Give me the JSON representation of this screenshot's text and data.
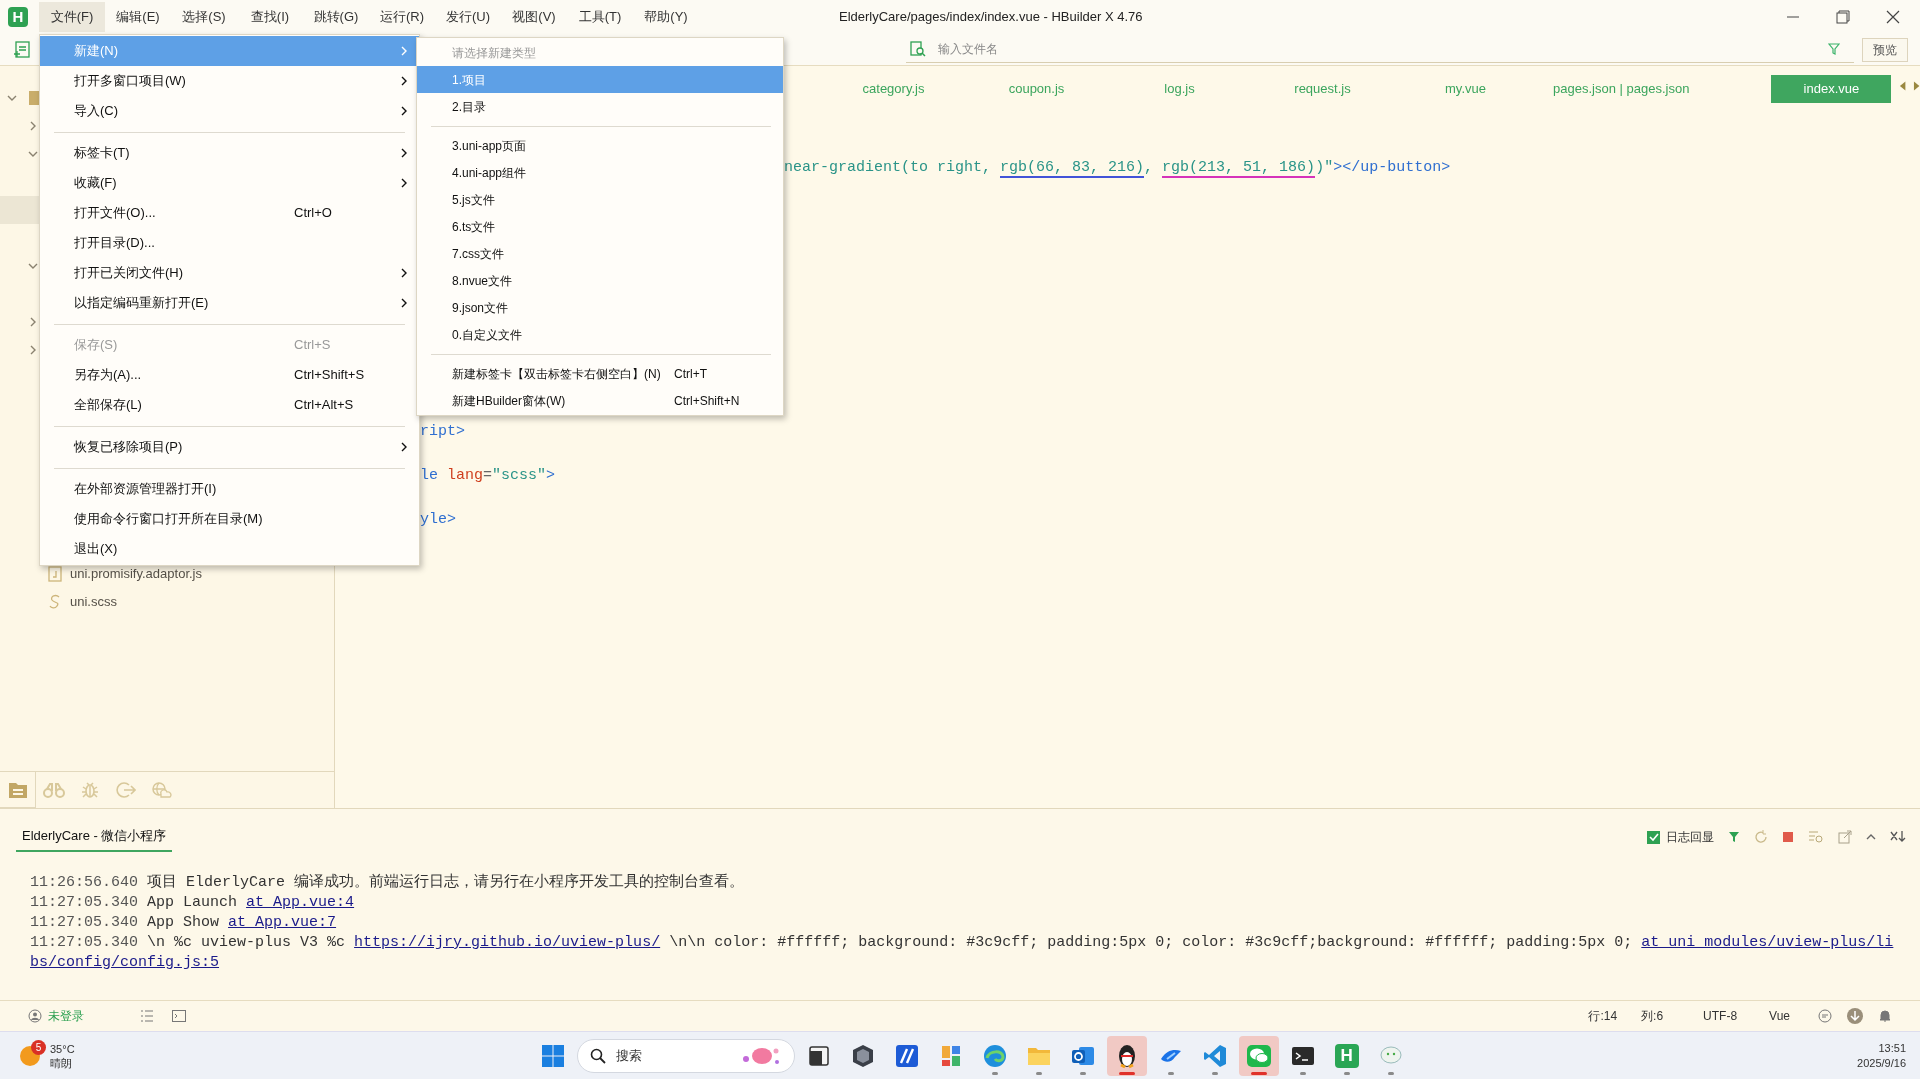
{
  "window": {
    "logo": "H",
    "title": "ElderlyCare/pages/index/index.vue - HBuilder X 4.76"
  },
  "menubar": [
    {
      "label": "文件(F)",
      "selected": true
    },
    {
      "label": "编辑(E)",
      "selected": false
    },
    {
      "label": "选择(S)",
      "selected": false
    },
    {
      "label": "查找(I)",
      "selected": false
    },
    {
      "label": "跳转(G)",
      "selected": false
    },
    {
      "label": "运行(R)",
      "selected": false
    },
    {
      "label": "发行(U)",
      "selected": false
    },
    {
      "label": "视图(V)",
      "selected": false
    },
    {
      "label": "工具(T)",
      "selected": false
    },
    {
      "label": "帮助(Y)",
      "selected": false
    }
  ],
  "file_menu": [
    {
      "kind": "item",
      "label": "新建(N)",
      "submenu": true,
      "selected": true,
      "disabled": false
    },
    {
      "kind": "item",
      "label": "打开多窗口项目(W)",
      "submenu": true,
      "selected": false,
      "disabled": false
    },
    {
      "kind": "item",
      "label": "导入(C)",
      "submenu": true,
      "selected": false,
      "disabled": false
    },
    {
      "kind": "separator"
    },
    {
      "kind": "item",
      "label": "标签卡(T)",
      "submenu": true,
      "selected": false,
      "disabled": false
    },
    {
      "kind": "item",
      "label": "收藏(F)",
      "submenu": true,
      "selected": false,
      "disabled": false
    },
    {
      "kind": "item",
      "label": "打开文件(O)...",
      "shortcut": "Ctrl+O",
      "submenu": false,
      "selected": false,
      "disabled": false
    },
    {
      "kind": "item",
      "label": "打开目录(D)...",
      "submenu": false,
      "selected": false,
      "disabled": false
    },
    {
      "kind": "item",
      "label": "打开已关闭文件(H)",
      "submenu": true,
      "selected": false,
      "disabled": false
    },
    {
      "kind": "item",
      "label": "以指定编码重新打开(E)",
      "submenu": true,
      "selected": false,
      "disabled": false
    },
    {
      "kind": "separator"
    },
    {
      "kind": "item",
      "label": "保存(S)",
      "shortcut": "Ctrl+S",
      "submenu": false,
      "selected": false,
      "disabled": true
    },
    {
      "kind": "item",
      "label": "另存为(A)...",
      "shortcut": "Ctrl+Shift+S",
      "submenu": false,
      "selected": false,
      "disabled": false
    },
    {
      "kind": "item",
      "label": "全部保存(L)",
      "shortcut": "Ctrl+Alt+S",
      "submenu": false,
      "selected": false,
      "disabled": false
    },
    {
      "kind": "separator"
    },
    {
      "kind": "item",
      "label": "恢复已移除项目(P)",
      "submenu": true,
      "selected": false,
      "disabled": false
    },
    {
      "kind": "separator"
    },
    {
      "kind": "item",
      "label": "在外部资源管理器打开(I)",
      "submenu": false,
      "selected": false,
      "disabled": false
    },
    {
      "kind": "item",
      "label": "使用命令行窗口打开所在目录(M)",
      "submenu": false,
      "selected": false,
      "disabled": false
    },
    {
      "kind": "item",
      "label": "退出(X)",
      "submenu": false,
      "selected": false,
      "disabled": false
    }
  ],
  "new_submenu": [
    {
      "kind": "header",
      "label": "请选择新建类型"
    },
    {
      "kind": "item",
      "label": "1.项目",
      "selected": true
    },
    {
      "kind": "item",
      "label": "2.目录",
      "selected": false
    },
    {
      "kind": "separator"
    },
    {
      "kind": "item",
      "label": "3.uni-app页面",
      "selected": false
    },
    {
      "kind": "item",
      "label": "4.uni-app组件",
      "selected": false
    },
    {
      "kind": "item",
      "label": "5.js文件",
      "selected": false
    },
    {
      "kind": "item",
      "label": "6.ts文件",
      "selected": false
    },
    {
      "kind": "item",
      "label": "7.css文件",
      "selected": false
    },
    {
      "kind": "item",
      "label": "8.nvue文件",
      "selected": false
    },
    {
      "kind": "item",
      "label": "9.json文件",
      "selected": false
    },
    {
      "kind": "item",
      "label": "0.自定义文件",
      "selected": false
    },
    {
      "kind": "separator"
    },
    {
      "kind": "item",
      "label": "新建标签卡【双击标签卡右侧空白】(N)",
      "shortcut": "Ctrl+T",
      "selected": false
    },
    {
      "kind": "item",
      "label": "新建HBuilder窗体(W)",
      "shortcut": "Ctrl+Shift+N",
      "selected": false
    }
  ],
  "toolbar": {
    "search": {
      "placeholder": "输入文件名"
    },
    "preview_button": "预览"
  },
  "sidebar": {
    "tree": [
      {
        "kind": "project",
        "expanded": true,
        "selected": false
      },
      {
        "kind": "folder",
        "expanded": false,
        "selected": false
      },
      {
        "kind": "folder",
        "expanded": true,
        "selected": false
      },
      {
        "kind": "row",
        "selected": true
      },
      {
        "kind": "folder",
        "expanded": true,
        "selected": false
      },
      {
        "kind": "folder",
        "expanded": false,
        "selected": false
      },
      {
        "kind": "folder",
        "expanded": false,
        "selected": false
      },
      {
        "kind": "script",
        "label": "uni.promisify.adaptor.js",
        "selected": false
      },
      {
        "kind": "style",
        "label": "uni.scss",
        "selected": false
      }
    ],
    "bottom_tabs": [
      {
        "kind": "folder",
        "selected": true
      },
      {
        "kind": "binoculars",
        "selected": false
      },
      {
        "kind": "bug",
        "selected": false
      },
      {
        "kind": "export",
        "selected": false
      },
      {
        "kind": "cloud",
        "selected": false
      }
    ]
  },
  "tabs": [
    {
      "label": "category.js",
      "selected": false
    },
    {
      "label": "coupon.js",
      "selected": false
    },
    {
      "label": "log.js",
      "selected": false
    },
    {
      "label": "request.js",
      "selected": false
    },
    {
      "label": "my.vue",
      "selected": false
    },
    {
      "label": "pages.json | pages.json",
      "selected": false
    },
    {
      "label": "index.vue",
      "selected": true
    }
  ],
  "code_lines": [
    {
      "segments": [
        {
          "kind": "string",
          "text": "near-gradient(to right, "
        },
        {
          "kind": "string",
          "text": "rgb(66, 83, 216)",
          "color": "#4253d8"
        },
        {
          "kind": "string",
          "text": ", "
        },
        {
          "kind": "string",
          "text": "rgb(213, 51, 186)",
          "color": "#d533ba"
        },
        {
          "kind": "string",
          "text": ")\""
        },
        {
          "kind": "tag",
          "text": "></up-button>"
        }
      ]
    },
    {
      "segments": [
        {
          "kind": "tag",
          "text": "ript>"
        }
      ]
    },
    {
      "segments": [
        {
          "kind": "tag",
          "text": "le "
        },
        {
          "kind": "attr",
          "text": "lang"
        },
        {
          "kind": "plain",
          "text": "="
        },
        {
          "kind": "string",
          "text": "\"scss\""
        },
        {
          "kind": "tag",
          "text": ">"
        }
      ]
    },
    {
      "segments": [
        {
          "kind": "tag",
          "text": "yle>"
        }
      ]
    }
  ],
  "console": {
    "tab": "ElderlyCare - 微信小程序",
    "log_echo": {
      "label": "日志回显",
      "checked": true
    },
    "lines": [
      {
        "segments": [
          {
            "kind": "time",
            "text": "11:26:56.640"
          },
          {
            "kind": "text",
            "text": " 项目 ElderlyCare 编译成功。前端运行日志，请另行在小程序开发工具的控制台查看。"
          }
        ]
      },
      {
        "segments": [
          {
            "kind": "time",
            "text": "11:27:05.340"
          },
          {
            "kind": "text",
            "text": " App Launch "
          },
          {
            "kind": "link",
            "text": "at App.vue:4"
          }
        ]
      },
      {
        "segments": [
          {
            "kind": "time",
            "text": "11:27:05.340"
          },
          {
            "kind": "text",
            "text": " App Show "
          },
          {
            "kind": "link",
            "text": "at App.vue:7"
          }
        ]
      },
      {
        "segments": [
          {
            "kind": "time",
            "text": "11:27:05.340"
          },
          {
            "kind": "text",
            "text": " \\n %c uview-plus V3 %c "
          },
          {
            "kind": "link",
            "text": "https://ijry.github.io/uview-plus/"
          },
          {
            "kind": "text",
            "text": " \\n\\n color: #ffffff; background: #3c9cff; padding:5px 0; color: #3c9cff;background: #ffffff; padding:5px 0; "
          },
          {
            "kind": "link",
            "text": "at uni_modules/uview-plus/li"
          }
        ]
      },
      {
        "segments": [
          {
            "kind": "link",
            "text": "bs/config/config.js:5"
          }
        ]
      }
    ]
  },
  "status_bar": {
    "user": "未登录",
    "line": "行:14",
    "column": "列:6",
    "encoding": "UTF-8",
    "language": "Vue"
  },
  "taskbar": {
    "weather": {
      "badge": "5",
      "temp": "35°C",
      "condition": "晴朗"
    },
    "search": "搜索",
    "apps": [
      {
        "kind": "box",
        "running": false,
        "active": false
      },
      {
        "kind": "hexagon",
        "running": false,
        "active": false
      },
      {
        "kind": "slash",
        "running": false,
        "active": false
      },
      {
        "kind": "tiles",
        "running": false,
        "active": false
      },
      {
        "kind": "browser",
        "running": true,
        "active": false
      },
      {
        "kind": "folder",
        "running": true,
        "active": false
      },
      {
        "kind": "mail",
        "running": true,
        "active": false
      },
      {
        "kind": "penguin",
        "running": true,
        "active": true
      },
      {
        "kind": "bird",
        "running": true,
        "active": false
      },
      {
        "kind": "code",
        "running": true,
        "active": false
      },
      {
        "kind": "chat",
        "running": true,
        "active": true
      },
      {
        "kind": "terminal",
        "running": true,
        "active": false
      },
      {
        "kind": "letter",
        "label": "H",
        "running": true,
        "active": false
      },
      {
        "kind": "bubble",
        "running": true,
        "active": false
      }
    ],
    "time": "13:51",
    "date": "2025/9/16"
  }
}
